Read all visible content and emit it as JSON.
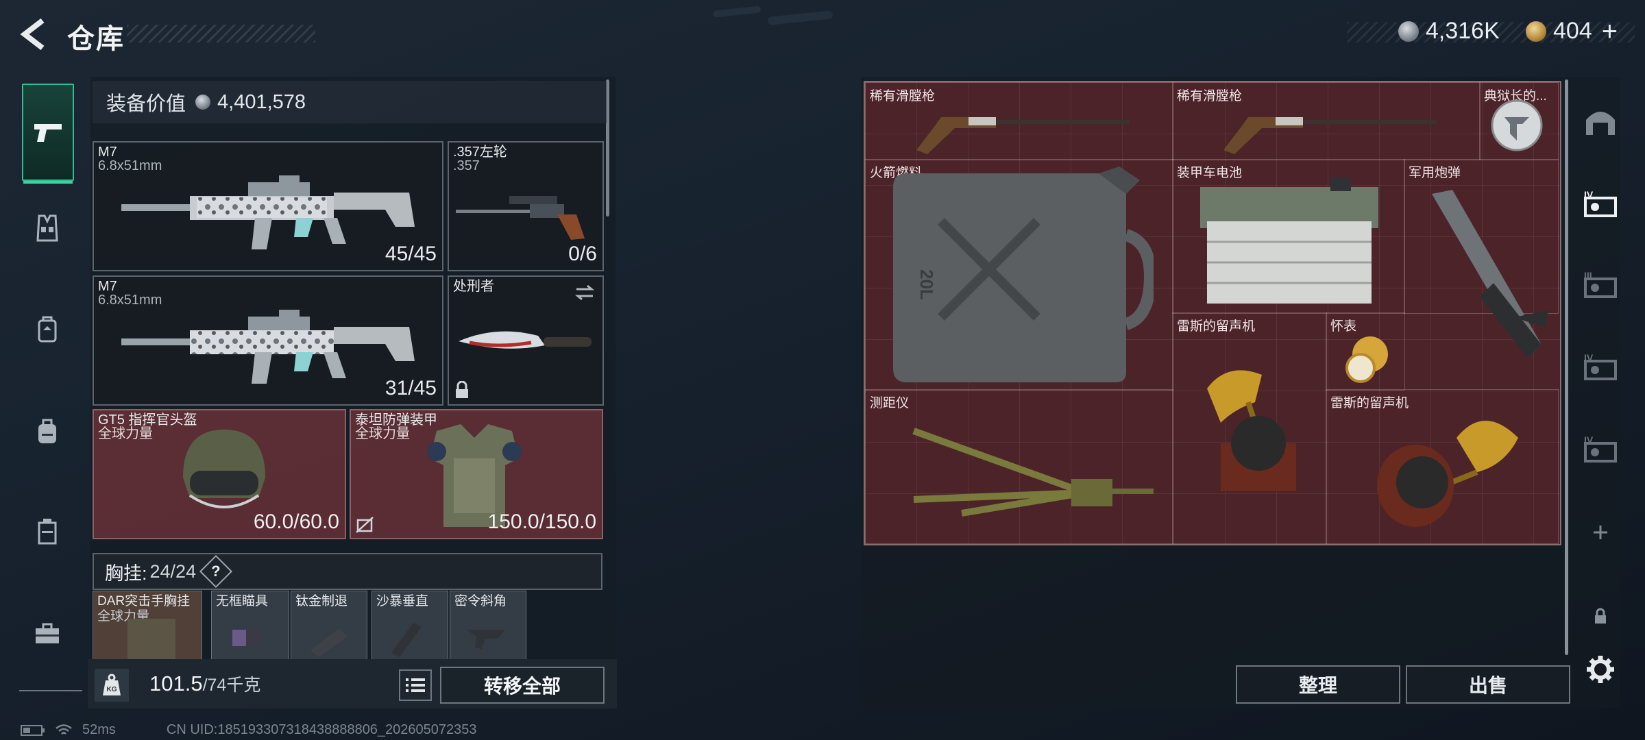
{
  "header": {
    "title": "仓库"
  },
  "currency": {
    "silver": "4,316K",
    "gold": "404",
    "plus": "+"
  },
  "equipment": {
    "value_label": "装备价值",
    "value": "4,401,578",
    "primary1": {
      "name": "M7",
      "caliber": "6.8x51mm",
      "ammo": "45/45"
    },
    "pistol": {
      "name": ".357左轮",
      "caliber": ".357",
      "ammo": "0/6"
    },
    "primary2": {
      "name": "M7",
      "caliber": "6.8x51mm",
      "ammo": "31/45"
    },
    "melee": {
      "name": "处刑者"
    },
    "helmet": {
      "name": "GT5 指挥官头盔",
      "faction": "全球力量",
      "durability": "60.0/60.0"
    },
    "armor": {
      "name": "泰坦防弹装甲",
      "faction": "全球力量",
      "durability": "150.0/150.0"
    },
    "chest": {
      "label": "胸挂:",
      "count": "24/24",
      "help": "?"
    },
    "chest_item": {
      "name": "DAR突击手胸挂",
      "faction": "全球力量"
    },
    "attachments": [
      "无框瞄具",
      "钛金制退",
      "沙暴垂直",
      "密令斜角"
    ],
    "weight": {
      "current": "101.5",
      "limit": "/74千克"
    },
    "transfer_all": "转移全部"
  },
  "stash": {
    "items": [
      {
        "name": "稀有滑膛枪"
      },
      {
        "name": "稀有滑膛枪"
      },
      {
        "name": "典狱长的..."
      },
      {
        "name": "火箭燃料"
      },
      {
        "name": "装甲车电池"
      },
      {
        "name": "军用炮弹"
      },
      {
        "name": "雷斯的留声机"
      },
      {
        "name": "怀表"
      },
      {
        "name": "测距仪"
      },
      {
        "name": "雷斯的留声机"
      }
    ],
    "canister_label": "20L",
    "tidy": "整理",
    "sell": "出售"
  },
  "right_nav": [
    "IV",
    "III",
    "IV",
    "IV"
  ],
  "status": {
    "ping": "52ms",
    "uid": "CN UID:185193307318438888806_202605072353"
  },
  "colors": {
    "accent": "#36d59d",
    "stash_bg": "#4c2329",
    "slot_red": "#78343a"
  }
}
